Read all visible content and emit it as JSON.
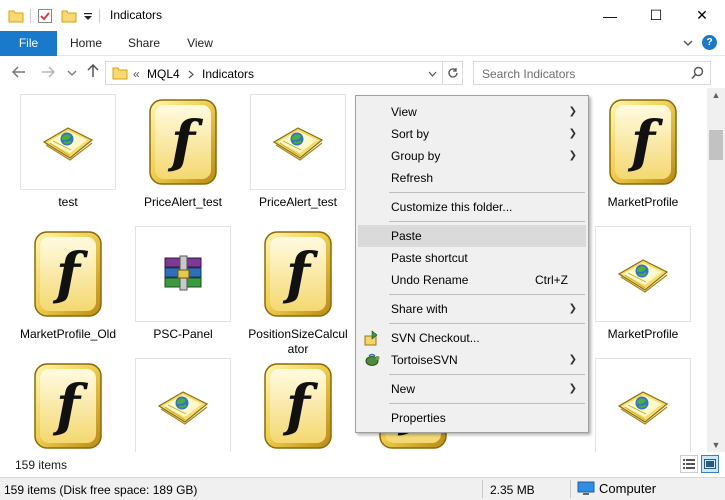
{
  "window": {
    "title": "Indicators",
    "min_glyph": "—",
    "max_glyph": "☐",
    "close_glyph": "✕"
  },
  "ribbon": {
    "tabs": [
      "File",
      "Home",
      "Share",
      "View"
    ]
  },
  "address": {
    "overflow": "«",
    "crumbs": [
      "MQL4",
      "Indicators"
    ],
    "search_placeholder": "Search Indicators"
  },
  "files": [
    {
      "name": "test",
      "icon": "mql-source-file-icon"
    },
    {
      "name": "PriceAlert_test",
      "icon": "mql-executable-icon"
    },
    {
      "name": "PriceAlert_test",
      "icon": "mql-source-file-icon"
    },
    {
      "name": "",
      "icon": "hidden"
    },
    {
      "name": "",
      "icon": "hidden"
    },
    {
      "name": "MarketProfile",
      "icon": "mql-executable-icon"
    },
    {
      "name": "MarketProfile_Old",
      "icon": "mql-executable-icon"
    },
    {
      "name": "PSC-Panel",
      "icon": "winrar-archive-icon"
    },
    {
      "name": "PositionSizeCalculator",
      "icon": "mql-executable-icon"
    },
    {
      "name": "",
      "icon": "hidden"
    },
    {
      "name": "",
      "icon": "hidden"
    },
    {
      "name": "MarketProfile",
      "icon": "mql-source-file-icon"
    },
    {
      "name": "",
      "icon": "mql-executable-icon"
    },
    {
      "name": "",
      "icon": "mql-source-file-icon"
    },
    {
      "name": "",
      "icon": "mql-executable-icon"
    },
    {
      "name": "",
      "icon": "mql-executable-icon"
    },
    {
      "name": "",
      "icon": "hidden"
    },
    {
      "name": "",
      "icon": "mql-source-file-icon"
    }
  ],
  "status": {
    "item_count": "159 items",
    "info": "159 items (Disk free space: 189 GB)",
    "size": "2.35 MB",
    "location": "Computer"
  },
  "context_menu": {
    "items": [
      {
        "label": "View",
        "submenu": true
      },
      {
        "label": "Sort by",
        "submenu": true
      },
      {
        "label": "Group by",
        "submenu": true
      },
      {
        "label": "Refresh"
      },
      {
        "label": "Customize this folder..."
      },
      {
        "label": "Paste",
        "highlighted": true
      },
      {
        "label": "Paste shortcut"
      },
      {
        "label": "Undo Rename",
        "shortcut": "Ctrl+Z"
      },
      {
        "label": "Share with",
        "submenu": true
      },
      {
        "label": "SVN Checkout...",
        "icon": "svn-checkout-icon"
      },
      {
        "label": "TortoiseSVN",
        "icon": "tortoisesvn-icon",
        "submenu": true
      },
      {
        "label": "New",
        "submenu": true
      },
      {
        "label": "Properties"
      }
    ],
    "submenu_glyph": "❯"
  },
  "colors": {
    "accent": "#1979ca",
    "menu_bg": "#f0f0f0",
    "menu_hover": "#dadada"
  }
}
